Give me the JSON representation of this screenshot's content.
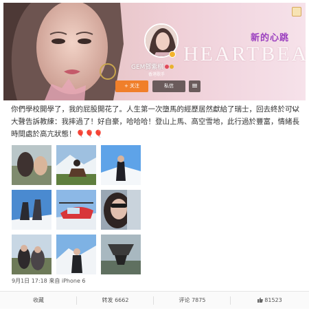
{
  "profile": {
    "cover_title": "新的心跳",
    "cover_word": "HEARTBEAT",
    "name": "GEM鄧紫棋",
    "subtitle": "香港歌手",
    "follow_label": "+ 关注",
    "message_label": "私信"
  },
  "post": {
    "text": "你們學校開學了，我的屁股開花了。人生第一次墮馬的經歷居然獻給了瑞士，回去終於可以大聲告訴教練：我摔過了！好自豪，哈哈哈！登山上馬、高空雪地，此行過於豐富，情緒長時間處於高亢狀態！",
    "balloons": "🎈🎈🎈",
    "timestamp": "9月1日 17:18 来自 iPhone 6"
  },
  "actions": {
    "collect_label": "收藏",
    "repost_label": "转发 6662",
    "comment_label": "评论 7875",
    "like_label": "81523"
  },
  "colors": {
    "follow_button": "#f07f2a",
    "dark_button": "#6a5b5b",
    "cover_accent": "#9b3fbf"
  }
}
